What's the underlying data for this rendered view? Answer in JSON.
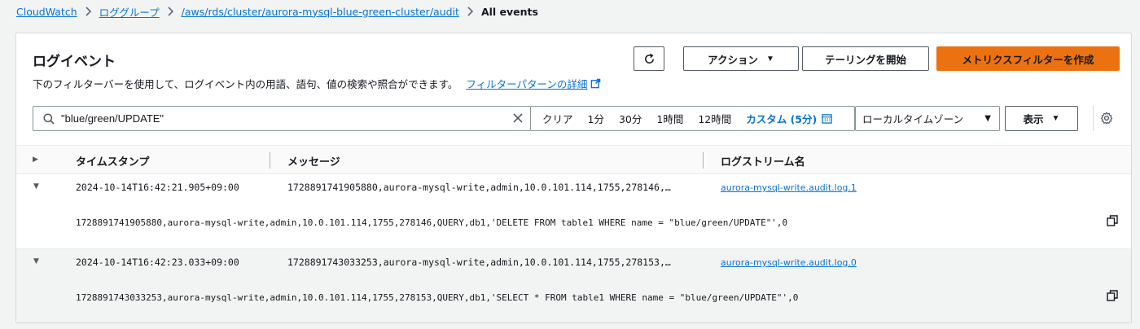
{
  "breadcrumb": {
    "items": [
      "CloudWatch",
      "ロググループ",
      "/aws/rds/cluster/aurora-mysql-blue-green-cluster/audit"
    ],
    "current": "All events"
  },
  "panel": {
    "title": "ログイベント",
    "description": "下のフィルターバーを使用して、ログイベント内の用語、語句、値の検索や照合ができます。",
    "description_link": "フィルターパターンの詳細"
  },
  "toolbar": {
    "action_label": "アクション",
    "tail_label": "テーリングを開始",
    "create_metric_filter_label": "メトリクスフィルターを作成"
  },
  "search": {
    "value": "\"blue/green/UPDATE\"",
    "placeholder": ""
  },
  "time_range": {
    "clear": "クリア",
    "options": [
      "1分",
      "30分",
      "1時間",
      "12時間"
    ],
    "active": "カスタム (5分)"
  },
  "timezone": {
    "selected": "ローカルタイムゾーン"
  },
  "display_label": "表示",
  "table": {
    "columns": [
      "タイムスタンプ",
      "メッセージ",
      "ログストリーム名"
    ],
    "rows": [
      {
        "timestamp": "2024-10-14T16:42:21.905+09:00",
        "message": "1728891741905880,aurora-mysql-write,admin,10.0.101.114,1755,278146,…",
        "log_stream": "aurora-mysql-write.audit.log.1",
        "full_message": "1728891741905880,aurora-mysql-write,admin,10.0.101.114,1755,278146,QUERY,db1,'DELETE FROM table1 WHERE name = \"blue/green/UPDATE\"',0"
      },
      {
        "timestamp": "2024-10-14T16:42:23.033+09:00",
        "message": "1728891743033253,aurora-mysql-write,admin,10.0.101.114,1755,278153,…",
        "log_stream": "aurora-mysql-write.audit.log.0",
        "full_message": "1728891743033253,aurora-mysql-write,admin,10.0.101.114,1755,278153,QUERY,db1,'SELECT * FROM table1 WHERE name = \"blue/green/UPDATE\"',0"
      }
    ]
  },
  "colors": {
    "link": "#0972d3",
    "primary": "#ec7211",
    "background": "#f2f3f3"
  }
}
